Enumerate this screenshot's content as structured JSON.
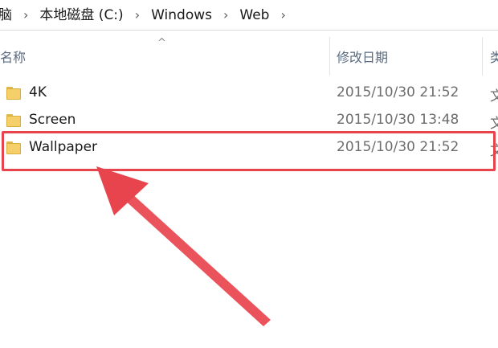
{
  "breadcrumb": {
    "items": [
      "脑",
      "本地磁盘 (C:)",
      "Windows",
      "Web"
    ],
    "separator": "›"
  },
  "columns": {
    "sort_indicator": "^",
    "name": "名称",
    "modified": "修改日期",
    "type": "类"
  },
  "files": [
    {
      "name": "4K",
      "modified": "2015/10/30 21:52",
      "type": "文"
    },
    {
      "name": "Screen",
      "modified": "2015/10/30 13:48",
      "type": "文"
    },
    {
      "name": "Wallpaper",
      "modified": "2015/10/30 21:52",
      "type": "文"
    }
  ],
  "colors": {
    "highlight": "#e8444e",
    "folder": "#f4cf6a"
  },
  "icons": {
    "folder": "folder-icon",
    "annotation_arrow": "arrow-icon"
  }
}
